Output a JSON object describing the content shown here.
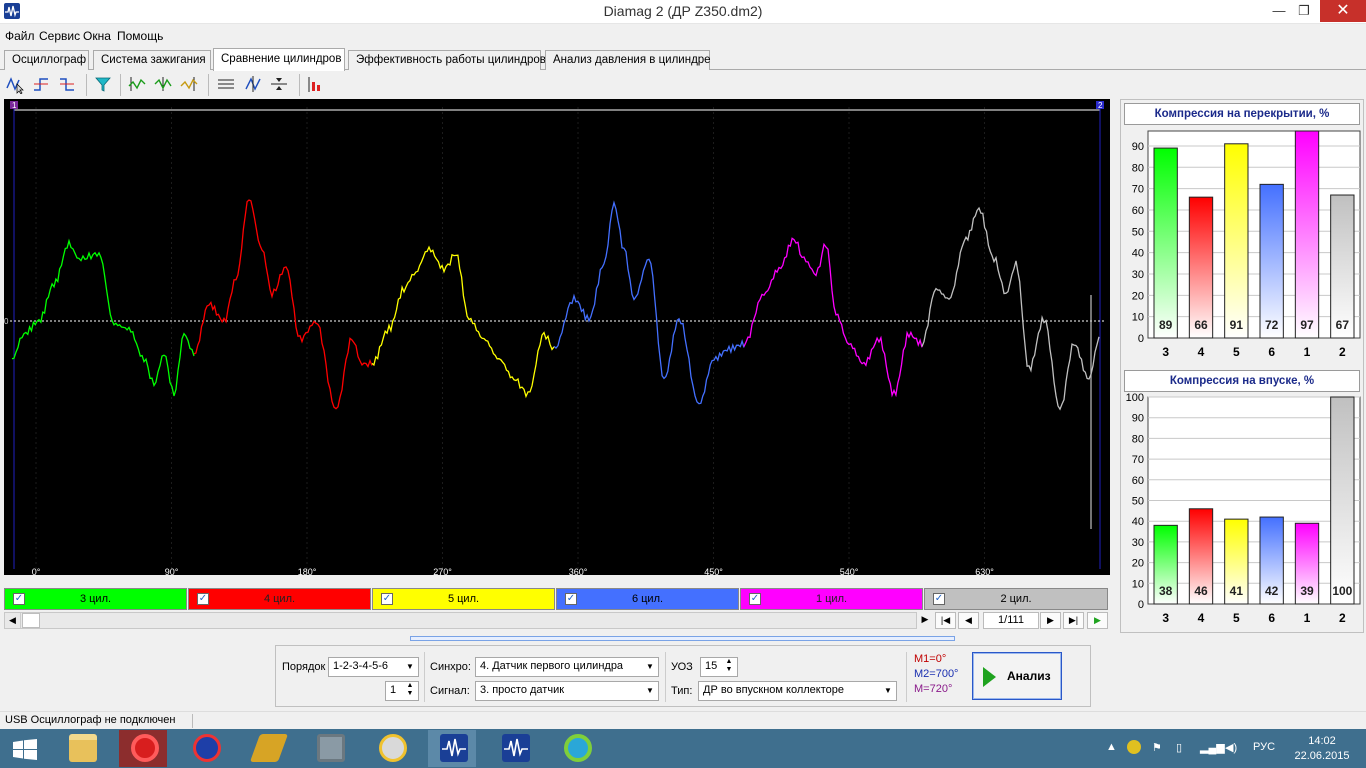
{
  "window": {
    "title": "Diamag 2 (ДР Z350.dm2)",
    "min": "—",
    "max": "❐",
    "close": "✕"
  },
  "menu": [
    "Файл",
    "Сервис",
    "Окна",
    "Помощь"
  ],
  "tabs": [
    "Осциллограф",
    "Система зажигания",
    "Сравнение цилиндров",
    "Эффективность работы цилиндров",
    "Анализ давления в цилиндре"
  ],
  "active_tab": "Сравнение цилиндров",
  "scope": {
    "marker_left": "1",
    "marker_right": "2",
    "zero_label": "0",
    "degree_labels": [
      "0°",
      "90°",
      "180°",
      "270°",
      "360°",
      "450°",
      "540°",
      "630°"
    ],
    "grid_color": "#1a1a1a",
    "zero_line_color": "#ffffff"
  },
  "cylinders": [
    {
      "label": "3 цил.",
      "color": "#00ff00",
      "checked": true
    },
    {
      "label": "4 цил.",
      "color": "#ff0000",
      "checked": true
    },
    {
      "label": "5 цил.",
      "color": "#ffff00",
      "checked": true
    },
    {
      "label": "6 цил.",
      "color": "#4470ff",
      "checked": true
    },
    {
      "label": "1 цил.",
      "color": "#ff00ff",
      "checked": true
    },
    {
      "label": "2 цил.",
      "color": "#c0c0c0",
      "checked": true
    }
  ],
  "navigation": {
    "frame": "1/111",
    "first": "|◀",
    "prev": "◀",
    "next": "▶",
    "last": "▶|",
    "play": "▶"
  },
  "controls": {
    "order_label": "Порядок",
    "order_value": "1-2-3-4-5-6",
    "order_spin": "1",
    "sync_label": "Синхро:",
    "sync_value": "4. Датчик первого цилиндра",
    "signal_label": "Сигнал:",
    "signal_value": "3. просто датчик",
    "uoz_label": "УОЗ",
    "uoz_value": "15",
    "type_label": "Тип:",
    "type_value": "ДР во впускном коллекторе",
    "m1": "M1=0°",
    "m2": "M2=700°",
    "m3": "M=720°",
    "analyze": "Анализ"
  },
  "chart_data": [
    {
      "type": "bar",
      "title": "Компрессия на перекрытии, %",
      "categories": [
        "3",
        "4",
        "5",
        "6",
        "1",
        "2"
      ],
      "values": [
        89,
        66,
        91,
        72,
        97,
        67
      ],
      "colors": [
        "#00ff00",
        "#ff0000",
        "#ffff00",
        "#4470ff",
        "#ff00ff",
        "#c0c0c0"
      ],
      "ylim": [
        0,
        97
      ],
      "yticks": [
        "0",
        "10",
        "20",
        "30",
        "40",
        "50",
        "60",
        "70",
        "80",
        "90"
      ],
      "grid": true
    },
    {
      "type": "bar",
      "title": "Компрессия на впуске, %",
      "categories": [
        "3",
        "4",
        "5",
        "6",
        "1",
        "2"
      ],
      "values": [
        38,
        46,
        41,
        42,
        39,
        100
      ],
      "colors": [
        "#00ff00",
        "#ff0000",
        "#ffff00",
        "#4470ff",
        "#ff00ff",
        "#c0c0c0"
      ],
      "ylim": [
        0,
        100
      ],
      "yticks": [
        "0",
        "10",
        "20",
        "30",
        "40",
        "50",
        "60",
        "70",
        "80",
        "90",
        "100"
      ],
      "grid": true
    }
  ],
  "status": "USB Осциллограф не подключен",
  "taskbar": {
    "lang": "РУС",
    "time": "14:02",
    "date": "22.06.2015",
    "apps": [
      "start-icon",
      "file-explorer-icon",
      "opera-icon",
      "media-center-icon",
      "pen-icon",
      "gadget-icon",
      "disk-icon",
      "diamag-icon",
      "diamag2-icon",
      "sync-icon"
    ]
  }
}
